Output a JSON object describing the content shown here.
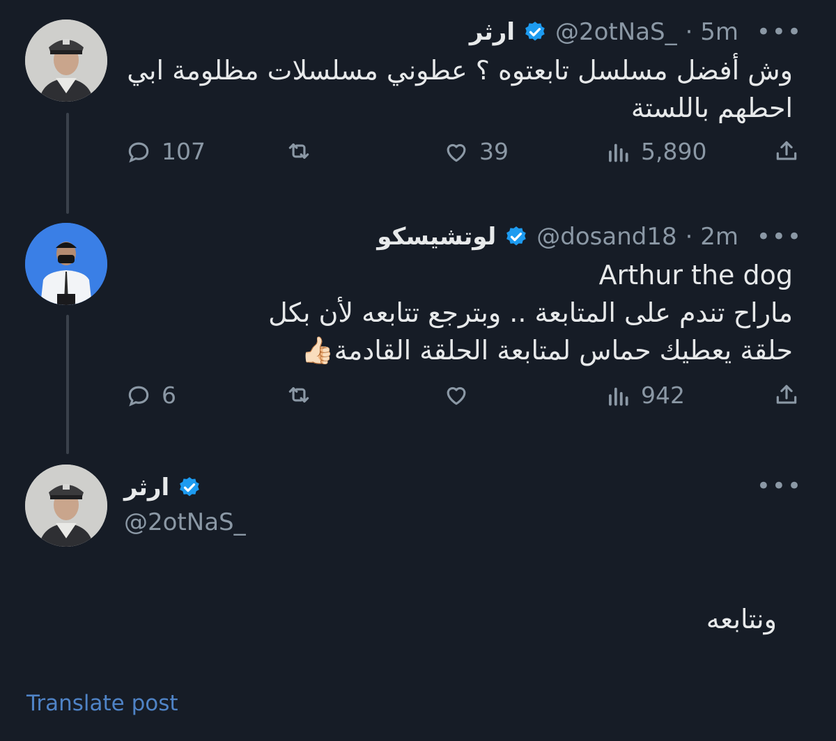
{
  "tweet1": {
    "name": "ارثر",
    "handle": "@2otNaS_",
    "time": " · 5m",
    "text_line1": "وش أفضل مسلسل تابعتوه ؟ عطوني مسلسلات مظلومة ابي",
    "text_line2": "احطهم باللستة",
    "replies": "107",
    "likes": "39",
    "views": "5,890"
  },
  "tweet2": {
    "name": "لوتشيسكو",
    "handle": "@dosand18",
    "time": " · 2m",
    "text_line1": "Arthur the dog",
    "text_line2": "ماراح تندم على المتابعة .. وبترجع تتابعه لأن بكل",
    "text_line3": "حلقة يعطيك حماس لمتابعة الحلقة القادمة👍🏻",
    "replies": "6",
    "likes": "",
    "views": "942"
  },
  "tweet3": {
    "name": "ارثر",
    "handle": "@2otNaS_",
    "text": "ونتابعه"
  },
  "footer": {
    "translate_label": "Translate post"
  },
  "icons": {
    "verified": "verified-badge-icon",
    "more": "more-icon",
    "reply": "reply-icon",
    "retweet": "retweet-icon",
    "like": "like-icon",
    "views": "views-icon",
    "share": "share-icon"
  },
  "colors": {
    "background": "#161c26",
    "verified": "#1d9bf0",
    "muted": "#8b98a5",
    "link": "#4f83c6"
  }
}
